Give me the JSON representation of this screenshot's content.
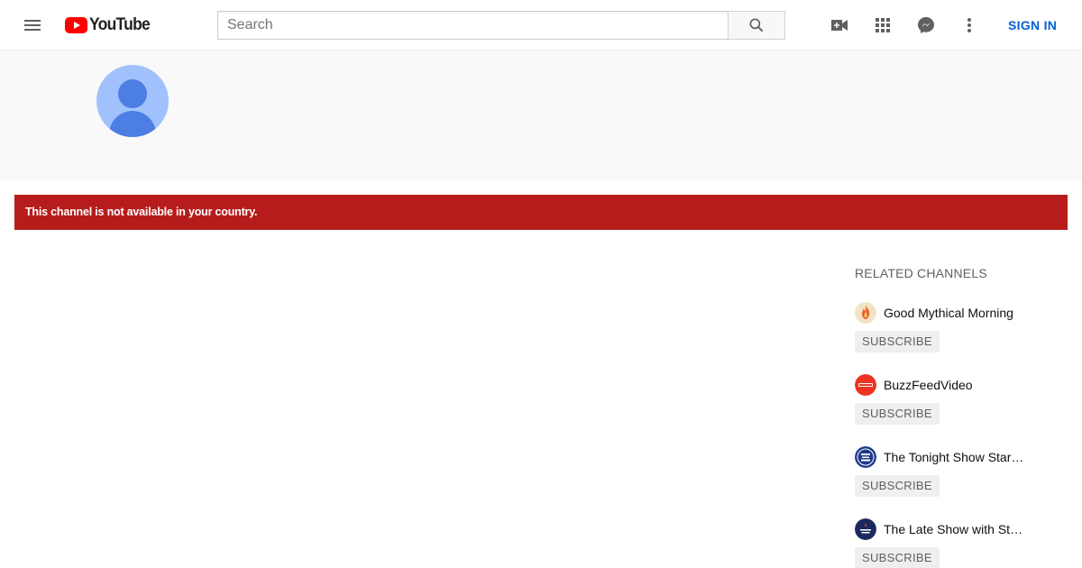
{
  "header": {
    "logo_text": "YouTube",
    "search": {
      "placeholder": "Search",
      "value": ""
    },
    "icons": [
      "menu-icon",
      "search-icon",
      "create-video-icon",
      "apps-grid-icon",
      "messages-icon",
      "more-vert-icon"
    ],
    "signin_label": "SIGN IN"
  },
  "channel": {
    "avatar": "default-avatar"
  },
  "alert": {
    "message": "This channel is not available in your country."
  },
  "related": {
    "title": "RELATED CHANNELS",
    "channels": [
      {
        "name": "Good Mythical Morning",
        "subscribe_label": "SUBSCRIBE"
      },
      {
        "name": "BuzzFeedVideo",
        "subscribe_label": "SUBSCRIBE"
      },
      {
        "name": "The Tonight Show Starring Jimmy Fallon",
        "subscribe_label": "SUBSCRIBE"
      },
      {
        "name": "The Late Show with Stephen Colbert",
        "subscribe_label": "SUBSCRIBE"
      }
    ]
  },
  "colors": {
    "brand_red": "#ff0000",
    "alert_bg": "#b71c1c",
    "link_blue": "#065fd4",
    "avatar_light": "#a0c1fb",
    "avatar_dark": "#4c7ee3"
  }
}
